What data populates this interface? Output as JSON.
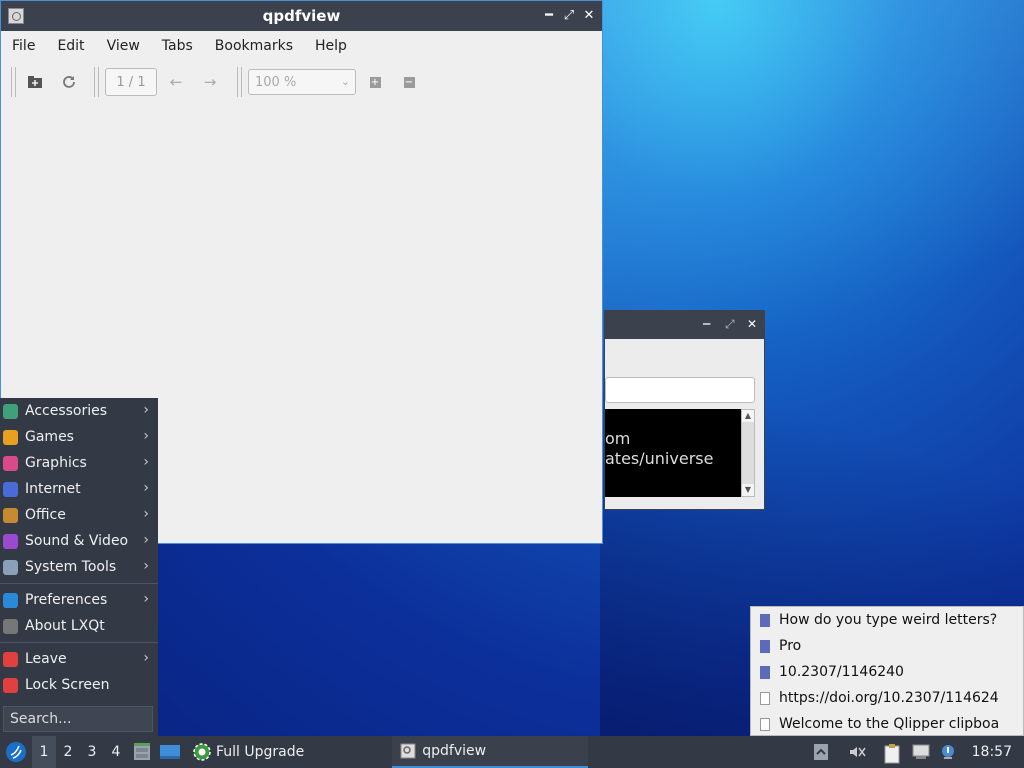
{
  "main_window": {
    "title": "qpdfview",
    "controls": {
      "minimize": "━",
      "maximize": "⤢",
      "close": "✕"
    },
    "menu": [
      "File",
      "Edit",
      "View",
      "Tabs",
      "Bookmarks",
      "Help"
    ],
    "toolbar": {
      "page_indicator": "1 / 1",
      "zoom_value": "100 %"
    }
  },
  "bg_window": {
    "terminal_lines": [
      "om",
      "ates/universe"
    ]
  },
  "start_menu": {
    "items": [
      {
        "label": "Accessories",
        "icon": "accessories-icon",
        "submenu": true,
        "color": "#3fa07a"
      },
      {
        "label": "Games",
        "icon": "games-icon",
        "submenu": true,
        "color": "#e8a020"
      },
      {
        "label": "Graphics",
        "icon": "graphics-icon",
        "submenu": true,
        "color": "#d84a8a"
      },
      {
        "label": "Internet",
        "icon": "internet-icon",
        "submenu": true,
        "color": "#4a6ad8"
      },
      {
        "label": "Office",
        "icon": "office-icon",
        "submenu": true,
        "color": "#c88a30"
      },
      {
        "label": "Sound & Video",
        "icon": "sound-video-icon",
        "submenu": true,
        "color": "#9a4ad0"
      },
      {
        "label": "System Tools",
        "icon": "system-tools-icon",
        "submenu": true,
        "color": "#8aa0b8"
      }
    ],
    "items2": [
      {
        "label": "Preferences",
        "icon": "preferences-icon",
        "submenu": true,
        "color": "#2a8ad8"
      },
      {
        "label": "About LXQt",
        "icon": "about-icon",
        "submenu": false,
        "color": "#777"
      }
    ],
    "items3": [
      {
        "label": "Leave",
        "icon": "leave-icon",
        "submenu": true,
        "color": "#e04040"
      },
      {
        "label": "Lock Screen",
        "icon": "lock-icon",
        "submenu": false,
        "color": "#e04040"
      }
    ],
    "search_placeholder": "Search..."
  },
  "clipboard": {
    "entries": [
      {
        "text": "How do you type weird letters?",
        "kind": "doc"
      },
      {
        "text": "Pro",
        "kind": "doc"
      },
      {
        "text": "10.2307/1146240",
        "kind": "doc"
      },
      {
        "text": "https://doi.org/10.2307/114624",
        "kind": "txt"
      },
      {
        "text": "Welcome to the Qlipper clipboa",
        "kind": "txt"
      }
    ]
  },
  "taskbar": {
    "workspaces": [
      "1",
      "2",
      "3",
      "4"
    ],
    "active_workspace": "1",
    "tasks": [
      {
        "label": "Full Upgrade",
        "icon": "upgrade-gear-icon"
      },
      {
        "label": "qpdfview",
        "icon": "qpdfview-icon"
      }
    ],
    "clock": "18:57"
  }
}
